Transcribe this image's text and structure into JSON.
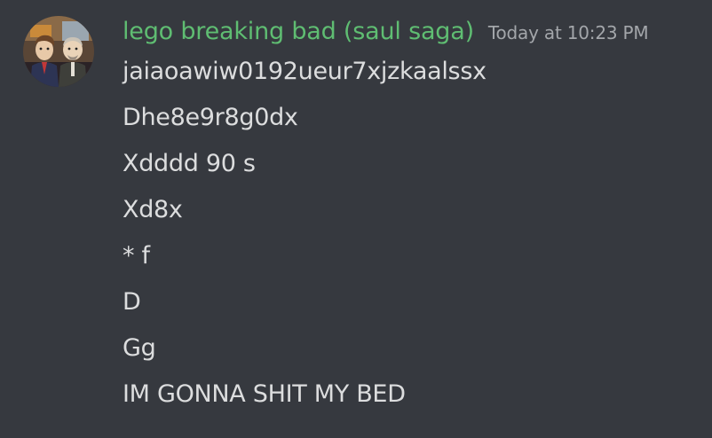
{
  "message": {
    "author": "lego breaking bad (saul saga)",
    "timestamp": "Today at 10:23 PM",
    "lines": [
      "jaiaoawiw0192ueur7xjzkaalssx",
      "Dhe8e9r8g0dx",
      "Xdddd 90 s",
      "Xd8x",
      "* f",
      "D",
      "Gg",
      "IM GONNA SHIT MY BED"
    ]
  },
  "colors": {
    "background": "#36393f",
    "username": "#5fbd72",
    "timestamp": "#a3a6aa",
    "text": "#dcddde"
  }
}
